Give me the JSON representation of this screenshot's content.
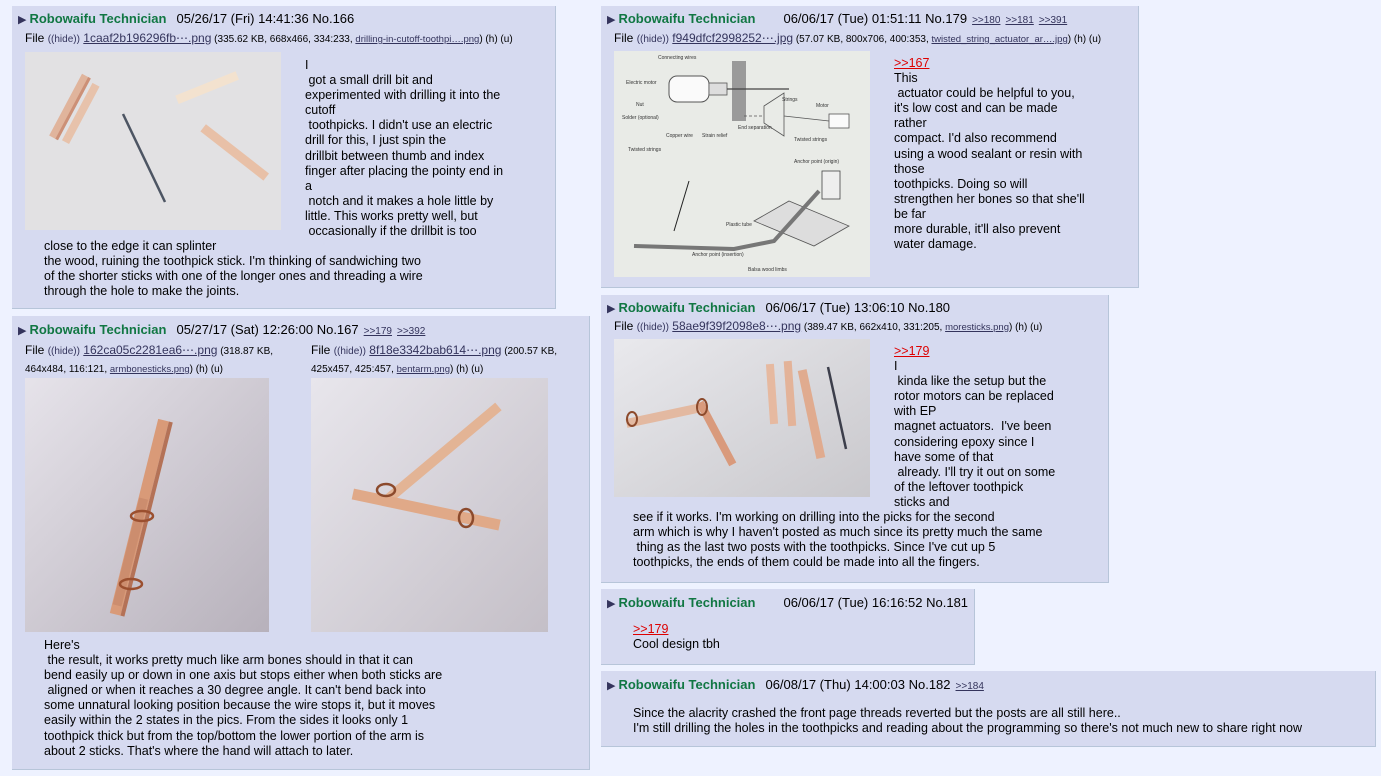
{
  "colors": {
    "page_bg": "#eef2ff",
    "post_bg": "#d6daf0",
    "name": "#117743",
    "link": "#34345c",
    "quotelink": "#dd0000"
  },
  "icons": {
    "post_arrow": "triangle-right-icon"
  },
  "posts": [
    {
      "name": "Robowaifu Technician",
      "datetime": "05/26/17 (Fri) 14:41:36",
      "no": "No.166",
      "file": {
        "label": "File",
        "hide": "(hide)",
        "name": "1caaf2b196296fb⋯.png",
        "meta": " (335.62 KB, 668x466, 334:233, ",
        "orig": "drilling-in-cutoff-toothpi….png",
        "after": ") (h) (u)"
      },
      "text_side": "I\n got a small drill bit and\nexperimented with drilling it into the\ncutoff\n toothpicks. I didn't use an electric\ndrill for this, I just spin the\ndrillbit between thumb and index\nfinger after placing the pointy end in\na\n notch and it makes a hole little by\nlittle. This works pretty well, but\n occasionally if the drillbit is too",
      "text_below": "close to the edge it can splinter\nthe wood, ruining the toothpick stick. I'm thinking of sandwiching two\nof the shorter sticks with one of the longer ones and threading a wire\nthrough the hole to make the joints."
    },
    {
      "name": "Robowaifu Technician",
      "datetime": "05/27/17 (Sat) 12:26:00",
      "no": "No.167",
      "backlinks": [
        ">>179",
        ">>392"
      ],
      "file1": {
        "label": "File",
        "hide": "(hide)",
        "name": "162ca05c2281ea6⋯.png",
        "meta": " (318.87 KB,",
        "meta2": "464x484, 116:121, ",
        "orig": "armbonesticks.png",
        "after": ") (h) (u)"
      },
      "file2": {
        "label": "File",
        "hide": "(hide)",
        "name": "8f18e3342bab614⋯.png",
        "meta": " (200.57 KB,",
        "meta2": "425x457, 425:457, ",
        "orig": "bentarm.png",
        "after": ") (h) (u)"
      },
      "text": "Here's\n the result, it works pretty much like arm bones should in that it can\nbend easily up or down in one axis but stops either when both sticks are\n aligned or when it reaches a 30 degree angle. It can't bend back into\nsome unnatural looking position because the wire stops it, but it moves\neasily within the 2 states in the pics. From the sides it looks only 1\ntoothpick thick but from the top/bottom the lower portion of the arm is\nabout 2 sticks. That's where the hand will attach to later."
    },
    {
      "name": "Robowaifu Technician",
      "datetime": "06/06/17 (Tue) 01:51:11",
      "no": "No.179",
      "backlinks": [
        ">>180",
        ">>181",
        ">>391"
      ],
      "file": {
        "label": "File",
        "hide": "(hide)",
        "name": "f949dfcf2998252⋯.jpg",
        "meta": " (57.07 KB, 800x706, 400:353, ",
        "orig": "twisted_string_actuator_ar….jpg",
        "after": ") (h) (u)"
      },
      "quote": ">>167",
      "text": "This\n actuator could be helpful to you,\nit's low cost and can be made\nrather\ncompact. I'd also recommend\nusing a wood sealant or resin with\nthose\ntoothpicks. Doing so will\nstrengthen her bones so that she'll\nbe far\nmore durable, it'll also prevent\nwater damage.",
      "diagram_labels": [
        "Connecting wires",
        "Electric motor",
        "Nut",
        "Solder (optional)",
        "Copper wire",
        "Strain relief",
        "Twisted strings",
        "End separation",
        "Strings",
        "Motor",
        "Twisted strings",
        "Anchor point (origin)",
        "Plastic tube",
        "Anchor point (insertion)",
        "Balsa wood limbs"
      ]
    },
    {
      "name": "Robowaifu Technician",
      "datetime": "06/06/17 (Tue) 13:06:10",
      "no": "No.180",
      "file": {
        "label": "File",
        "hide": "(hide)",
        "name": "58ae9f39f2098e8⋯.png",
        "meta": " (389.47 KB, 662x410, 331:205, ",
        "orig": "moresticks.png",
        "after": ") (h) (u)"
      },
      "quote": ">>179",
      "text_side": "I\n kinda like the setup but the\nrotor motors can be replaced\nwith EP\nmagnet actuators.  I've been\nconsidering epoxy since I\nhave some of that\n already. I'll try it out on some\nof the leftover toothpick\nsticks and",
      "text_below": "see if it works. I'm working on drilling into the picks for the second\narm which is why I haven't posted as much since its pretty much the same\n thing as the last two posts with the toothpicks. Since I've cut up 5\ntoothpicks, the ends of them could be made into all the fingers."
    },
    {
      "name": "Robowaifu Technician",
      "datetime": "06/06/17 (Tue) 16:16:52",
      "no": "No.181",
      "quote": ">>179",
      "text": "Cool design tbh"
    },
    {
      "name": "Robowaifu Technician",
      "datetime": "06/08/17 (Thu) 14:00:03",
      "no": "No.182",
      "backlinks": [
        ">>184"
      ],
      "text": "Since the alacrity crashed the front page threads reverted but the posts are all still here..\nI'm still drilling the holes in the toothpicks and reading about the programming so there's not much new to share right now"
    }
  ]
}
